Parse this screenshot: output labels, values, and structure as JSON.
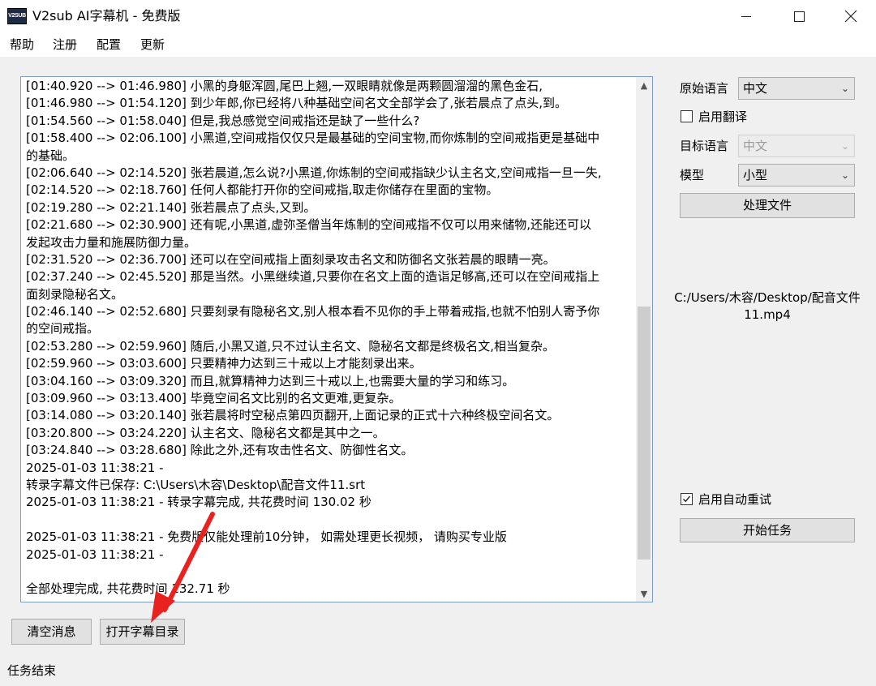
{
  "window": {
    "logo_text": "V2SUB",
    "title": "V2sub AI字幕机 - 免费版"
  },
  "menu": [
    "帮助",
    "注册",
    "配置",
    "更新"
  ],
  "log_lines": [
    "[01:40.920 --> 01:46.980]  小黑的身躯浑圆,尾巴上翘,一双眼睛就像是两颗圆溜溜的黑色金石,",
    "[01:46.980 --> 01:54.120]  到少年郎,你已经将八种基础空间名文全部学会了,张若晨点了点头,到。",
    "[01:54.560 --> 01:58.040]  但是,我总感觉空间戒指还是缺了一些什么?",
    "[01:58.400 --> 02:06.100]  小黑道,空间戒指仅仅只是最基础的空间宝物,而你炼制的空间戒指更是基础中",
    "的基础。",
    "[02:06.640 --> 02:14.520]  张若晨道,怎么说?小黑道,你炼制的空间戒指缺少认主名文,空间戒指一旦一失,",
    "[02:14.520 --> 02:18.760]  任何人都能打开你的空间戒指,取走你储存在里面的宝物。",
    "[02:19.280 --> 02:21.140]  张若晨点了点头,又到。",
    "[02:21.680 --> 02:30.900]  还有呢,小黑道,虚弥圣僧当年炼制的空间戒指不仅可以用来储物,还能还可以",
    "发起攻击力量和施展防御力量。",
    "[02:31.520 --> 02:36.700]  还可以在空间戒指上面刻录攻击名文和防御名文张若晨的眼睛一亮。",
    "[02:37.240 --> 02:45.520]  那是当然。小黑继续道,只要你在名文上面的造诣足够高,还可以在空间戒指上",
    "面刻录隐秘名文。",
    "[02:46.140 --> 02:52.680]  只要刻录有隐秘名文,别人根本看不见你的手上带着戒指,也就不怕别人寄予你",
    "的空间戒指。",
    "[02:53.280 --> 02:59.960]  随后,小黑又道,只不过认主名文、隐秘名文都是终极名文,相当复杂。",
    "[02:59.960 --> 03:03.600]  只要精神力达到三十戒以上才能刻录出来。",
    "[03:04.160 --> 03:09.320]  而且,就算精神力达到三十戒以上,也需要大量的学习和练习。",
    "[03:09.960 --> 03:13.400]  毕竟空间名文比别的名文更难,更复杂。",
    "[03:14.080 --> 03:20.140]  张若晨将时空秘点第四页翻开,上面记录的正式十六种终极空间名文。",
    "[03:20.800 --> 03:24.220]  认主名文、隐秘名文都是其中之一。",
    "[03:24.840 --> 03:28.680]  除此之外,还有攻击性名文、防御性名文。",
    "2025-01-03 11:38:21 -",
    "转录字幕文件已保存: C:\\Users\\木容\\Desktop\\配音文件11.srt",
    "2025-01-03 11:38:21 - 转录字幕完成, 共花费时间 130.02 秒",
    "",
    "2025-01-03 11:38:21 - 免费版仅能处理前10分钟，  如需处理更长视频，  请购买专业版",
    "2025-01-03 11:38:21 -",
    "",
    "全部处理完成, 共花费时间 132.71 秒"
  ],
  "buttons": {
    "clear": "清空消息",
    "open_dir": "打开字幕目录",
    "process": "处理文件",
    "start": "开始任务"
  },
  "settings": {
    "source_lang_label": "原始语言",
    "source_lang_value": "中文",
    "translate_label": "启用翻译",
    "translate_checked": false,
    "target_lang_label": "目标语言",
    "target_lang_value": "中文",
    "model_label": "模型",
    "model_value": "小型",
    "auto_retry_label": "启用自动重试",
    "auto_retry_checked": true
  },
  "file_path": "C:/Users/木容/Desktop/配音文件11.mp4",
  "status": "任务结束",
  "colors": {
    "annotation_arrow": "#e8231f",
    "panel_bg": "#f0f0f0",
    "button_bg": "#e1e1e1"
  }
}
